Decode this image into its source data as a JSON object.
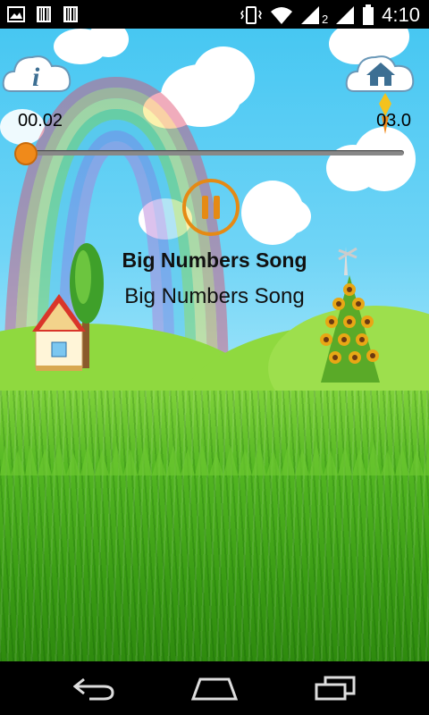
{
  "status_bar": {
    "time": "4:10",
    "signal_sim_label": "2",
    "icons": [
      "image-icon",
      "barcode-icon",
      "barcode-icon",
      "vibrate-icon",
      "wifi-icon",
      "signal-icon",
      "signal-icon",
      "battery-icon"
    ]
  },
  "player": {
    "elapsed": "00.02",
    "duration": "03.0",
    "progress": 0.0,
    "title": "Big Numbers Song",
    "subtitle": "Big Numbers Song",
    "accent_color": "#e58a14",
    "info_icon": "info-icon",
    "home_icon": "home-icon",
    "pause_icon": "pause-icon"
  },
  "nav_bar": {
    "icons": [
      "back-icon",
      "home-icon",
      "recent-apps-icon"
    ]
  }
}
